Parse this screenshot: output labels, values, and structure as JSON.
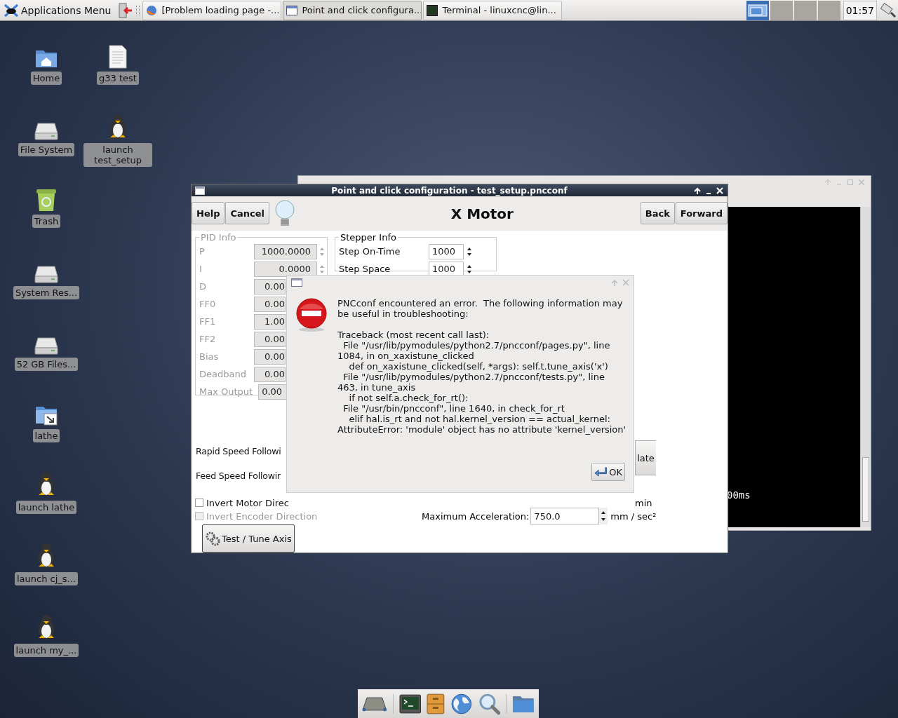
{
  "top_panel": {
    "apps_menu": "Applications Menu",
    "tasks": [
      {
        "label": "[Problem loading page -...",
        "kind": "browser",
        "selected": false
      },
      {
        "label": "Point and click configura...",
        "kind": "window",
        "selected": true
      },
      {
        "label": "Terminal - linuxcnc@lin...",
        "kind": "terminal",
        "selected": false
      }
    ],
    "workspaces": [
      {
        "selected": true
      },
      {
        "selected": false
      },
      {
        "selected": false
      },
      {
        "selected": false
      }
    ],
    "clock": "01:57"
  },
  "desktop_icons": [
    {
      "label": "Home",
      "kind": "home"
    },
    {
      "label": "File System",
      "kind": "drive"
    },
    {
      "label": "Trash",
      "kind": "trash"
    },
    {
      "label": "System Res...",
      "kind": "drive"
    },
    {
      "label": "52 GB Files...",
      "kind": "drive"
    },
    {
      "label": "lathe",
      "kind": "link"
    },
    {
      "label": "launch lathe",
      "kind": "penguin"
    },
    {
      "label": "launch cj_s...",
      "kind": "penguin"
    },
    {
      "label": "launch my_...",
      "kind": "penguin"
    },
    {
      "label": "g33 test",
      "kind": "file"
    },
    {
      "label": "launch test_setup",
      "kind": "penguin"
    }
  ],
  "terminal": {
    "output": "00ms"
  },
  "main_window": {
    "title": "Point and click configuration - test_setup.pncconf",
    "left_buttons": [
      "Help",
      "Cancel"
    ],
    "heading": "X Motor",
    "right_buttons": [
      "Back",
      "Forward"
    ],
    "pid": {
      "title": "PID Info",
      "disabled": true,
      "rows": [
        {
          "label": "P",
          "value": "1000.0000",
          "kind": "spin"
        },
        {
          "label": "I",
          "value": "0.0000",
          "kind": "spin"
        },
        {
          "label": "D",
          "value": "0.00",
          "kind": "cut"
        },
        {
          "label": "FF0",
          "value": "0.00",
          "kind": "cut"
        },
        {
          "label": "FF1",
          "value": "1.00",
          "kind": "cut"
        },
        {
          "label": "FF2",
          "value": "0.00",
          "kind": "cut"
        },
        {
          "label": "Bias",
          "value": "0.00",
          "kind": "cut"
        },
        {
          "label": "Deadband",
          "value": "0.00",
          "kind": "cut"
        },
        {
          "label": "Max Output",
          "value": "0.00",
          "kind": "left"
        }
      ]
    },
    "stepper": {
      "title": "Stepper Info",
      "rows": [
        {
          "label": "Step On-Time",
          "value": "1000"
        },
        {
          "label": "Step Space",
          "value": "1000"
        }
      ]
    },
    "rapid_label": "Rapid Speed Followi",
    "feed_label": "Feed Speed Followir",
    "calc_button": "late",
    "min_label": "min",
    "checkboxes": [
      {
        "label": "Invert Motor Direc",
        "checked": false,
        "disabled": false
      },
      {
        "label": "Invert Encoder Direction",
        "checked": false,
        "disabled": true
      }
    ],
    "accel": {
      "label": "Maximum Acceleration:",
      "value": "750.0",
      "unit": "mm / sec²"
    },
    "tune_button": "Test / Tune Axis"
  },
  "error_dialog": {
    "message": "PNCconf encountered an error.  The following information may\nbe useful in troubleshooting:",
    "traceback": "Traceback (most recent call last):\n  File \"/usr/lib/pymodules/python2.7/pncconf/pages.py\", line\n1084, in on_xaxistune_clicked\n    def on_xaxistune_clicked(self, *args): self.t.tune_axis('x')\n  File \"/usr/lib/pymodules/python2.7/pncconf/tests.py\", line\n463, in tune_axis\n    if not self.a.check_for_rt():\n  File \"/usr/bin/pncconf\", line 1640, in check_for_rt\n    elif hal.is_rt and not hal.kernel_version == actual_kernel:\nAttributeError: 'module' object has no attribute 'kernel_version'",
    "ok": "OK"
  }
}
